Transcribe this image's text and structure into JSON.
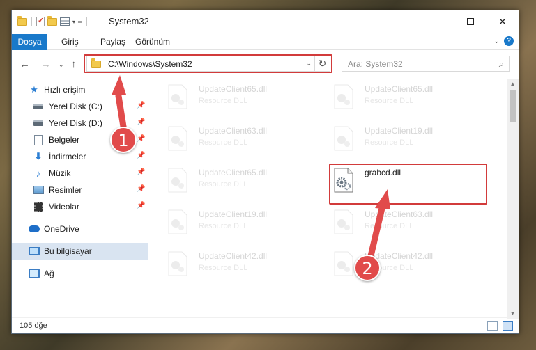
{
  "window": {
    "title": "System32",
    "minimize_label": "",
    "close_label": "✕"
  },
  "ribbon": {
    "tabs": [
      "Dosya",
      "Giriş",
      "Paylaş",
      "Görünüm"
    ]
  },
  "address_bar": {
    "path": "C:\\Windows\\System32",
    "search_placeholder": "Ara: System32"
  },
  "sidebar": {
    "items": [
      {
        "label": "Hızlı erişim",
        "icon": "star-icon",
        "pinned": false
      },
      {
        "label": "Yerel Disk (C:)",
        "icon": "disk-icon",
        "pinned": true
      },
      {
        "label": "Yerel Disk (D:)",
        "icon": "disk-icon",
        "pinned": true
      },
      {
        "label": "Belgeler",
        "icon": "document-icon",
        "pinned": true
      },
      {
        "label": "İndirmeler",
        "icon": "download-icon",
        "pinned": true
      },
      {
        "label": "Müzik",
        "icon": "music-icon",
        "pinned": true
      },
      {
        "label": "Resimler",
        "icon": "pictures-icon",
        "pinned": true
      },
      {
        "label": "Videolar",
        "icon": "video-icon",
        "pinned": true
      },
      {
        "label": "OneDrive",
        "icon": "cloud-icon",
        "pinned": false
      },
      {
        "label": "Bu bilgisayar",
        "icon": "computer-icon",
        "pinned": false,
        "selected": true
      },
      {
        "label": "Ağ",
        "icon": "network-icon",
        "pinned": false
      }
    ]
  },
  "files": [
    {
      "name": "UpdateClient65.dll",
      "type": "Resource DLL",
      "faded": true
    },
    {
      "name": "UpdateClient65.dll",
      "type": "Resource DLL",
      "faded": true
    },
    {
      "name": "UpdateClient63.dll",
      "type": "Resource DLL",
      "faded": true
    },
    {
      "name": "UpdateClient19.dll",
      "type": "Resource DLL",
      "faded": true
    },
    {
      "name": "UpdateClient65.dll",
      "type": "Resource DLL",
      "faded": true
    },
    {
      "name": "grabcd.dll",
      "type": "",
      "faded": false,
      "highlighted": true
    },
    {
      "name": "UpdateClient19.dll",
      "type": "Resource DLL",
      "faded": true
    },
    {
      "name": "UpdateClient63.dll",
      "type": "Resource DLL",
      "faded": true
    },
    {
      "name": "UpdateClient42.dll",
      "type": "Resource DLL",
      "faded": true
    },
    {
      "name": "UpdateClient42.dll",
      "type": "Resource DLL",
      "faded": true
    }
  ],
  "status": {
    "item_count": "105 öğe"
  },
  "annotations": {
    "step1": "1",
    "step2": "2",
    "color": "#e14b4b"
  }
}
